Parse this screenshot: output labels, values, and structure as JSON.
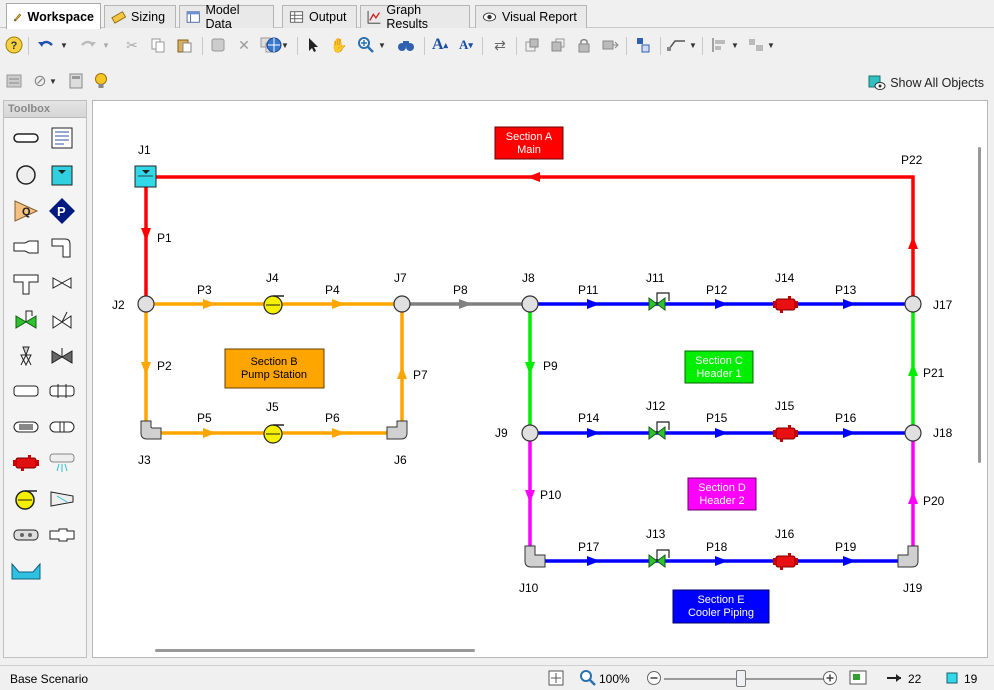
{
  "tabs": [
    {
      "label": "Workspace",
      "icon": "workspace-icon",
      "active": true
    },
    {
      "label": "Sizing",
      "icon": "ruler-icon"
    },
    {
      "label": "Model Data",
      "icon": "table-icon"
    },
    {
      "label": "Output",
      "icon": "output-table-icon"
    },
    {
      "label": "Graph Results",
      "icon": "graph-icon"
    },
    {
      "label": "Visual Report",
      "icon": "eye-icon"
    }
  ],
  "toolbar2": {
    "show_all_objects": "Show All Objects"
  },
  "toolbox": {
    "title": "Toolbox"
  },
  "diagram": {
    "annotations": [
      {
        "line1": "Section A",
        "line2": "Main",
        "color": "#ff0000",
        "text_color": "#ffffff"
      },
      {
        "line1": "Section B",
        "line2": "Pump Station",
        "color": "#ffa500",
        "text_color": "#000000"
      },
      {
        "line1": "Section C",
        "line2": "Header 1",
        "color": "#00ee00",
        "text_color": "#ffffff"
      },
      {
        "line1": "Section D",
        "line2": "Header 2",
        "color": "#ff00ff",
        "text_color": "#ffffff"
      },
      {
        "line1": "Section E",
        "line2": "Cooler Piping",
        "color": "#0000ff",
        "text_color": "#ffffff"
      }
    ],
    "junction_labels": [
      "J1",
      "J2",
      "J3",
      "J4",
      "J5",
      "J6",
      "J7",
      "J8",
      "J9",
      "J10",
      "J11",
      "J12",
      "J13",
      "J14",
      "J15",
      "J16",
      "J17",
      "J18",
      "J19"
    ],
    "pipe_labels": [
      "P1",
      "P2",
      "P3",
      "P4",
      "P5",
      "P6",
      "P7",
      "P8",
      "P9",
      "P10",
      "P11",
      "P12",
      "P13",
      "P14",
      "P15",
      "P16",
      "P17",
      "P18",
      "P19",
      "P20",
      "P21",
      "P22"
    ],
    "colors": {
      "main": "#ff0000",
      "pump_station": "#ffa500",
      "p8": "#808080",
      "header": "#0000ff",
      "c_header1": "#00ee00",
      "d_header2": "#ff00ff"
    }
  },
  "statusbar": {
    "scenario": "Base Scenario",
    "zoom": "100%",
    "zoom_fraction": 0.5,
    "pipe_count": "22",
    "junction_count": "19"
  }
}
